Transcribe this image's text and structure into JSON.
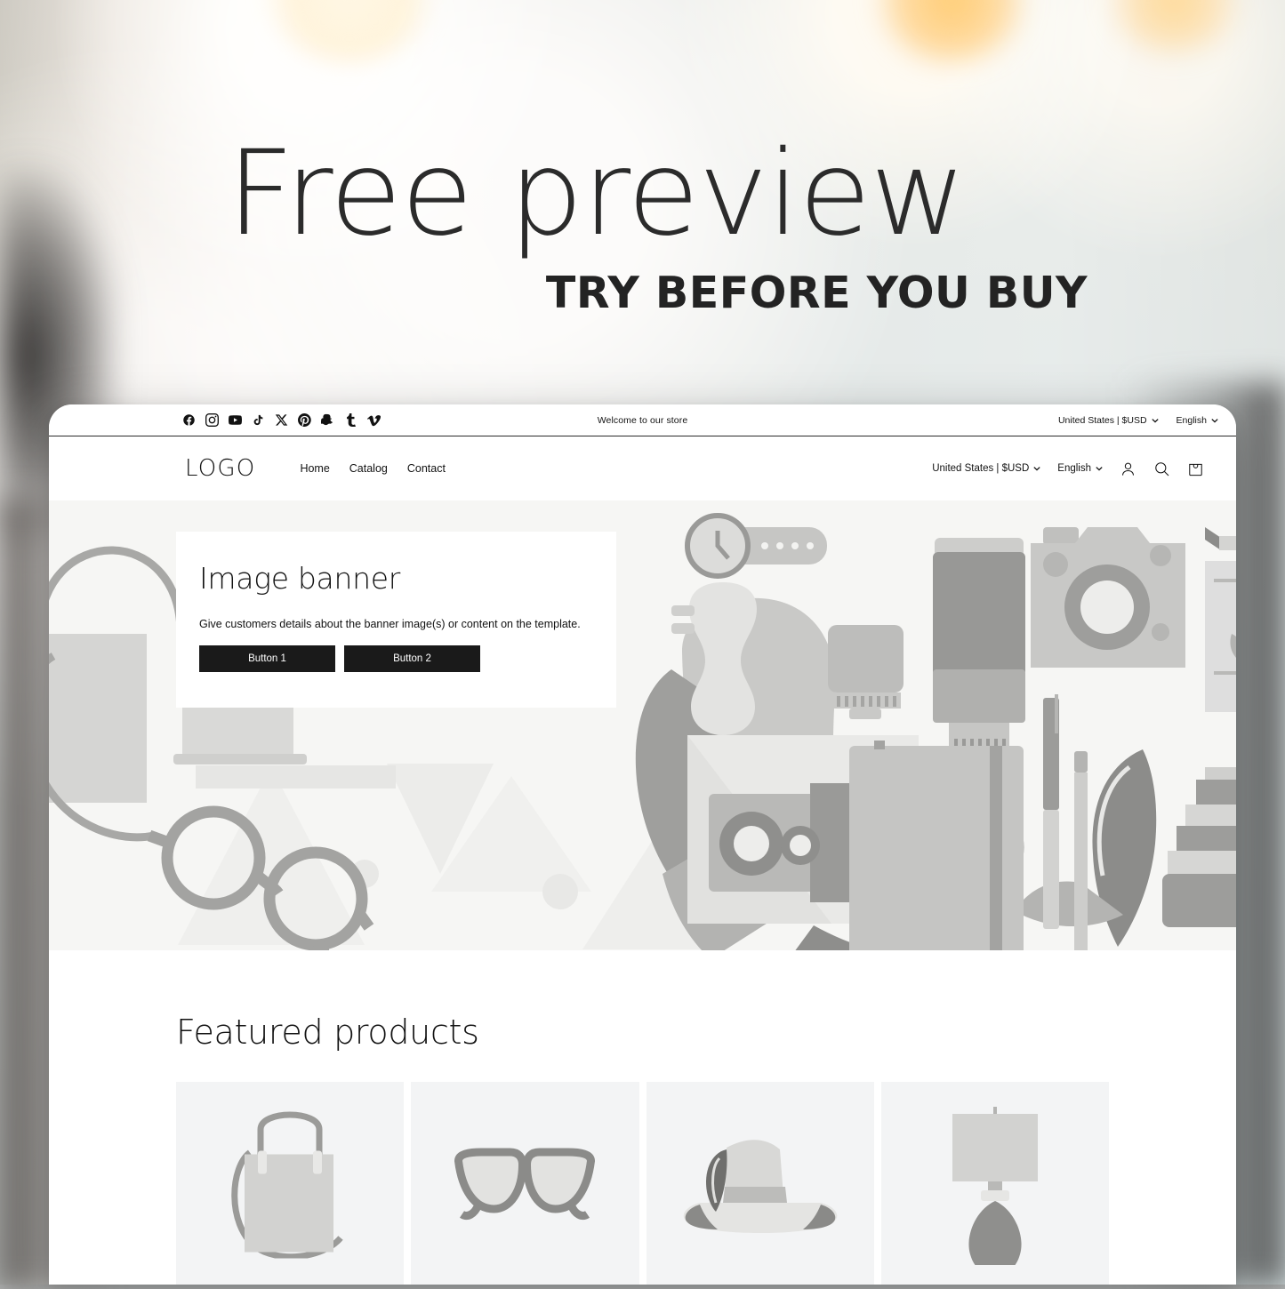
{
  "promo": {
    "title": "Free preview",
    "subtitle": "TRY BEFORE YOU BUY"
  },
  "browser": {
    "announcement": {
      "message": "Welcome to our store",
      "social_links": [
        {
          "name": "facebook-icon",
          "label": "Facebook"
        },
        {
          "name": "instagram-icon",
          "label": "Instagram"
        },
        {
          "name": "youtube-icon",
          "label": "YouTube"
        },
        {
          "name": "tiktok-icon",
          "label": "TikTok"
        },
        {
          "name": "x-icon",
          "label": "X"
        },
        {
          "name": "pinterest-icon",
          "label": "Pinterest"
        },
        {
          "name": "snapchat-icon",
          "label": "Snapchat"
        },
        {
          "name": "tumblr-icon",
          "label": "Tumblr"
        },
        {
          "name": "vimeo-icon",
          "label": "Vimeo"
        }
      ],
      "country_selector": "United States | $USD",
      "language_selector": "English"
    },
    "header": {
      "logo": "LOGO",
      "nav": [
        {
          "label": "Home"
        },
        {
          "label": "Catalog"
        },
        {
          "label": "Contact"
        }
      ],
      "country_selector": "United States | $USD",
      "language_selector": "English",
      "icons": [
        {
          "name": "account-icon",
          "label": "Log in"
        },
        {
          "name": "search-icon",
          "label": "Search"
        },
        {
          "name": "cart-icon",
          "label": "Cart"
        }
      ]
    },
    "hero": {
      "title": "Image banner",
      "text": "Give customers details about the banner image(s) or content on the template.",
      "buttons": [
        {
          "label": "Button 1"
        },
        {
          "label": "Button 2"
        }
      ]
    },
    "featured": {
      "title": "Featured products",
      "products": [
        {
          "name": "product-handbag",
          "label": "Handbag"
        },
        {
          "name": "product-glasses",
          "label": "Glasses"
        },
        {
          "name": "product-hat",
          "label": "Hat"
        },
        {
          "name": "product-lamp",
          "label": "Lamp"
        }
      ]
    }
  },
  "colors": {
    "text": "#121212",
    "button_bg": "#1a1a1a",
    "hero_bg": "#f6f6f4",
    "card_bg": "#f3f4f5",
    "window_bg": "#ffffff"
  }
}
